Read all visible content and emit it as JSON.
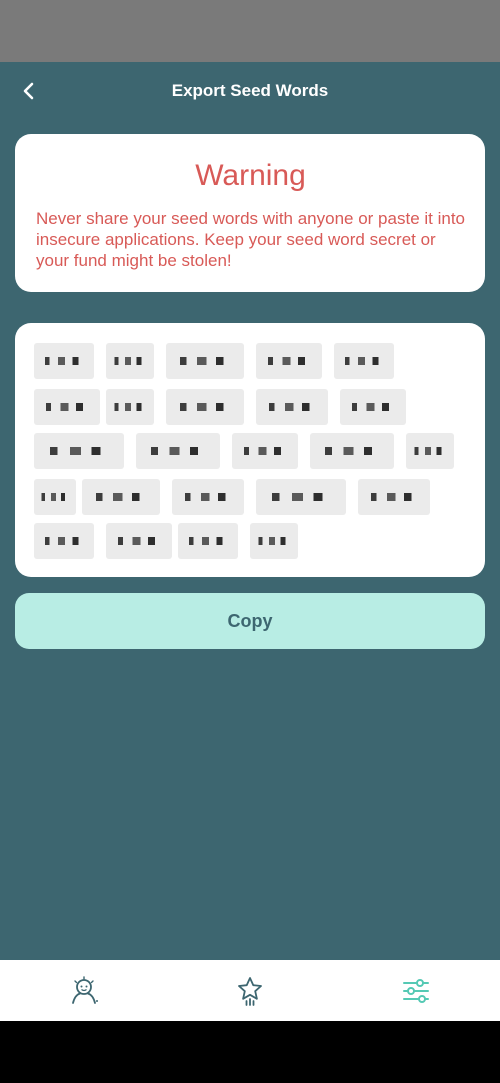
{
  "header": {
    "title": "Export Seed Words"
  },
  "warning": {
    "title": "Warning",
    "text": "Never share your seed words with anyone or paste it into insecure applications. Keep your seed word secret or your fund might be stolen!"
  },
  "seed_words": {
    "redacted": true
  },
  "copy_button": {
    "label": "Copy"
  },
  "colors": {
    "background": "#3d6670",
    "warning": "#d85a57",
    "copy_button": "#b8ede4",
    "active_nav": "#55c9b4"
  },
  "bottom_nav": {
    "items": [
      "profile-icon",
      "star-icon",
      "sliders-icon"
    ],
    "active": "sliders-icon"
  }
}
